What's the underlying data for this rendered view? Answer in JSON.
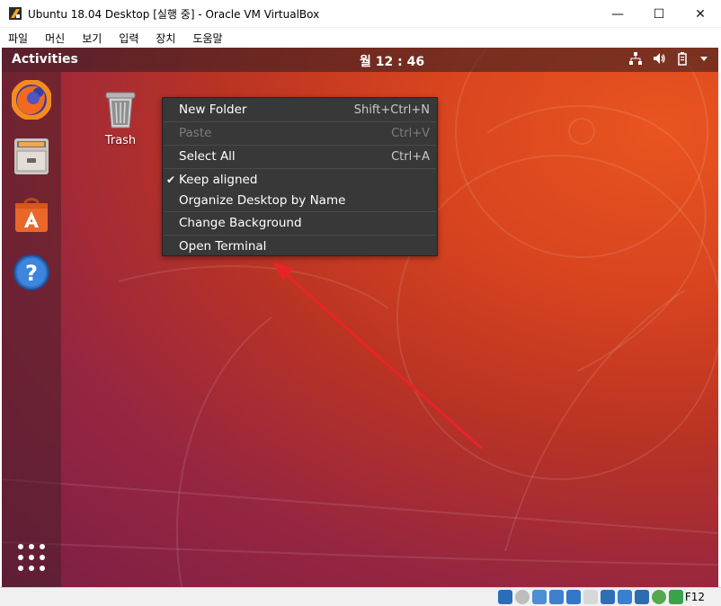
{
  "window": {
    "title": "Ubuntu 18.04 Desktop [실행 중] - Oracle VM VirtualBox",
    "controls": {
      "minimize": "—",
      "maximize": "☐",
      "close": "✕"
    }
  },
  "menubar": {
    "items": [
      "파일",
      "머신",
      "보기",
      "입력",
      "장치",
      "도움말"
    ]
  },
  "guest": {
    "topbar": {
      "activities": "Activities",
      "clock": "월 12 : 46"
    },
    "dock": {
      "items": [
        {
          "name": "firefox-icon"
        },
        {
          "name": "files-icon"
        },
        {
          "name": "software-icon"
        },
        {
          "name": "help-icon"
        }
      ],
      "show_apps_icon": "grid-icon"
    },
    "desktop": {
      "trash_label": "Trash"
    },
    "context_menu": {
      "items": [
        {
          "label": "New Folder",
          "accel": "Shift+Ctrl+N",
          "enabled": true
        },
        {
          "label": "Paste",
          "accel": "Ctrl+V",
          "enabled": false
        },
        {
          "label": "Select All",
          "accel": "Ctrl+A",
          "enabled": true
        },
        {
          "label": "Keep aligned",
          "accel": "",
          "enabled": true,
          "checked": true
        },
        {
          "label": "Organize Desktop by Name",
          "accel": "",
          "enabled": true
        },
        {
          "label": "Change Background",
          "accel": "",
          "enabled": true
        },
        {
          "label": "Open Terminal",
          "accel": "",
          "enabled": true
        }
      ],
      "check_mark": "✔"
    }
  },
  "statusbar": {
    "host_key": "F12"
  },
  "colors": {
    "arrow": "#e8232a",
    "menu_bg": "#383838",
    "ubuntu_orange": "#e95420"
  }
}
